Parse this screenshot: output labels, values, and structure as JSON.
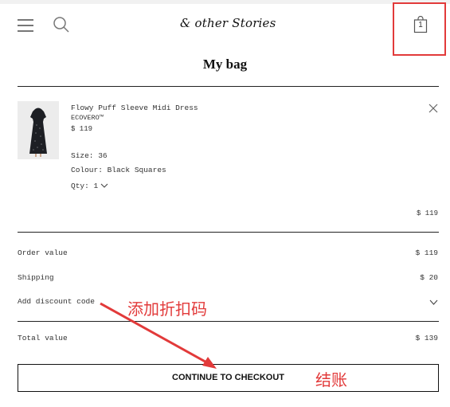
{
  "header": {
    "logo": "& other Stories",
    "bag_count": "1"
  },
  "page_title": "My bag",
  "item": {
    "name": "Flowy Puff Sleeve Midi Dress",
    "material": "ECOVERO™",
    "price": "$ 119",
    "size": "Size: 36",
    "colour": "Colour: Black Squares",
    "qty": "Qty: 1",
    "line_total": "$ 119"
  },
  "summary": {
    "order_value_label": "Order value",
    "order_value": "$ 119",
    "shipping_label": "Shipping",
    "shipping": "$ 20",
    "discount_label": "Add discount code",
    "total_label": "Total value",
    "total": "$ 139"
  },
  "checkout_label": "CONTINUE TO CHECKOUT",
  "annotations": {
    "discount_note": "添加折扣码",
    "checkout_note": "结账",
    "color": "#e23a3a"
  }
}
